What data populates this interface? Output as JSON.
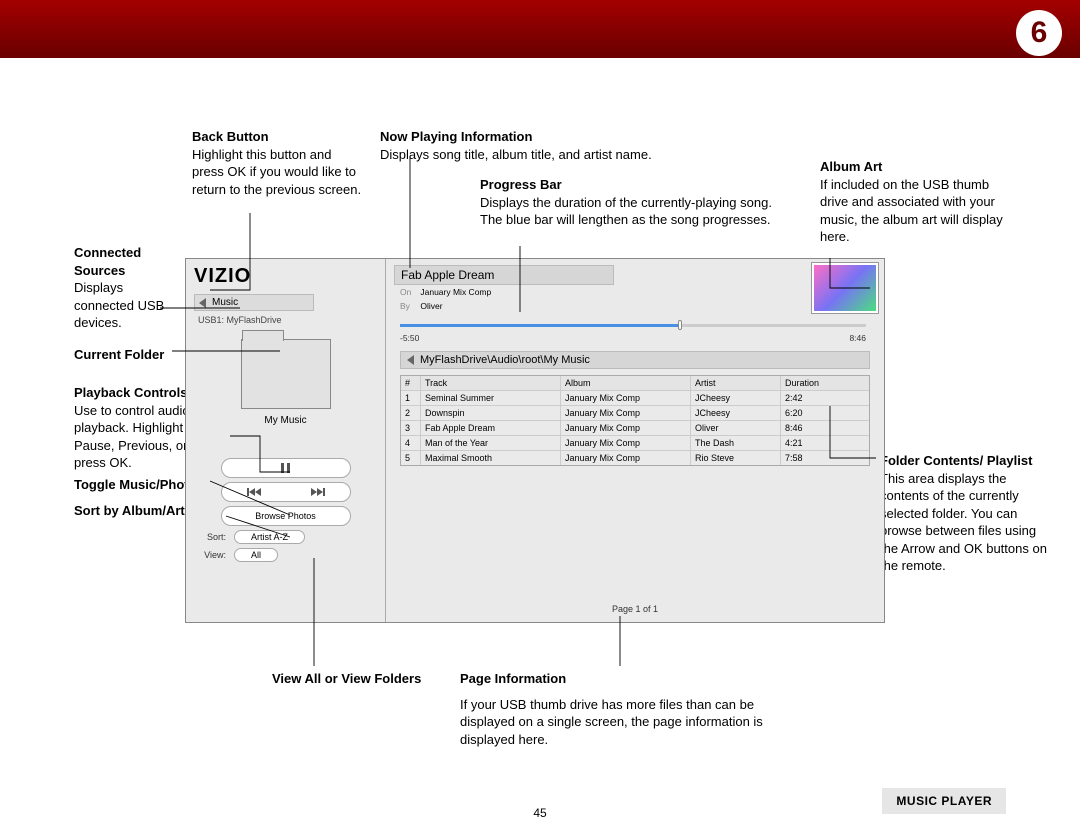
{
  "page": {
    "badge": "6",
    "number": "45",
    "chip": "MUSIC PLAYER"
  },
  "callouts": {
    "back": {
      "title": "Back Button",
      "body": "Highlight this button and press OK if you would like to return to the previous screen."
    },
    "sources": {
      "title": "Connected Sources",
      "body": "Displays connected USB devices."
    },
    "current": {
      "title": "Current Folder"
    },
    "playback": {
      "title": "Playback Controls",
      "body": "Use to control audio playback. Highlight Play/ Pause, Previous, or Next and press OK."
    },
    "toggle": {
      "title": "Toggle Music/Photos"
    },
    "sort": {
      "title": "Sort by Album/Artist/ Track"
    },
    "viewall": {
      "title": "View All or View Folders"
    },
    "np": {
      "title": "Now Playing Information",
      "body": "Displays song title, album title, and artist name."
    },
    "progress": {
      "title": "Progress Bar",
      "body": "Displays the duration of the currently-playing song. The blue bar will lengthen as the song progresses."
    },
    "art": {
      "title": "Album Art",
      "body": "If included on the USB thumb drive and associated with your music, the album art will display here."
    },
    "pageinfo": {
      "title": "Page Information",
      "body": "If your USB thumb drive has more files than can be displayed on a single screen, the page information is displayed here."
    },
    "contents": {
      "title": "Folder Contents/ Playlist",
      "body": "This area displays the contents of the currently selected folder. You can browse between files using the Arrow and OK buttons on the remote."
    }
  },
  "screen": {
    "brand": "VIZIO",
    "section": "Music",
    "source": "USB1: MyFlashDrive",
    "folder": "My Music",
    "browse": "Browse Photos",
    "sort_label": "Sort:",
    "sort_value": "Artist A-Z",
    "view_label": "View:",
    "view_value": "All",
    "now_title": "Fab Apple Dream",
    "now_on_k": "On",
    "now_on_v": "January Mix Comp",
    "now_by_k": "By",
    "now_by_v": "Oliver",
    "time_elapsed": "-5:50",
    "time_total": "8:46",
    "path": "MyFlashDrive\\Audio\\root\\My Music",
    "pageinfo": "Page 1 of 1",
    "headers": {
      "num": "#",
      "track": "Track",
      "album": "Album",
      "artist": "Artist",
      "duration": "Duration"
    },
    "rows": [
      {
        "num": "1",
        "track": "Seminal Summer",
        "album": "January Mix Comp",
        "artist": "JCheesy",
        "duration": "2:42"
      },
      {
        "num": "2",
        "track": "Downspin",
        "album": "January Mix Comp",
        "artist": "JCheesy",
        "duration": "6:20"
      },
      {
        "num": "3",
        "track": "Fab Apple Dream",
        "album": "January Mix Comp",
        "artist": "Oliver",
        "duration": "8:46"
      },
      {
        "num": "4",
        "track": "Man of the Year",
        "album": "January Mix Comp",
        "artist": "The Dash",
        "duration": "4:21"
      },
      {
        "num": "5",
        "track": "Maximal Smooth",
        "album": "January Mix Comp",
        "artist": "Rio Steve",
        "duration": "7:58"
      }
    ]
  }
}
